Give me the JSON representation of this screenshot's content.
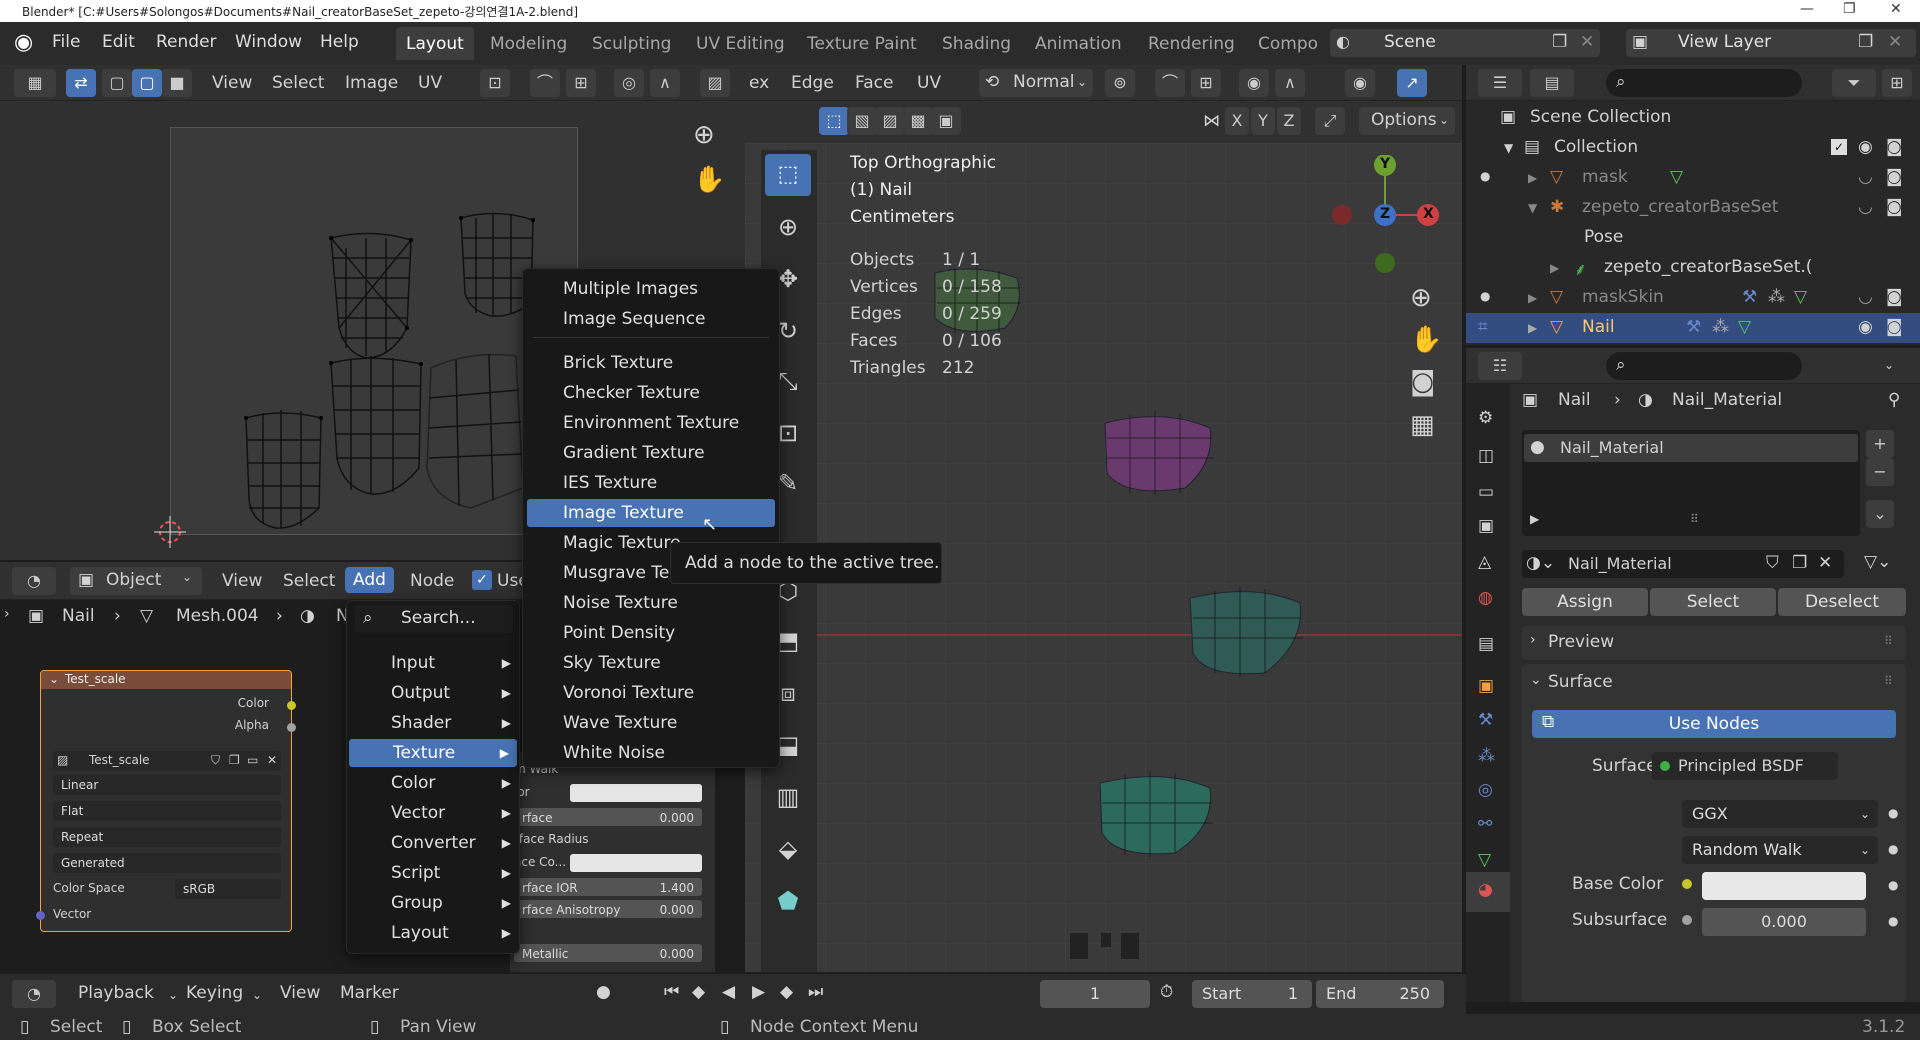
{
  "titlebar": {
    "title": "Blender* [C:#Users#Solongos#Documents#Nail_creatorBaseSet_zepeto-강의연결1A-2.blend]",
    "min": "—",
    "max": "❐",
    "close": "✕"
  },
  "menubar": {
    "items": [
      "File",
      "Edit",
      "Render",
      "Window",
      "Help"
    ]
  },
  "workspaces": {
    "tabs": [
      "Layout",
      "Modeling",
      "Sculpting",
      "UV Editing",
      "Texture Paint",
      "Shading",
      "Animation",
      "Rendering",
      "Compo"
    ]
  },
  "scene": {
    "name": "Scene",
    "view_layer": "View Layer"
  },
  "uv_editor": {
    "header": [
      "View",
      "Select",
      "Image",
      "UV"
    ]
  },
  "viewport": {
    "header": [
      "ex",
      "Edge",
      "Face",
      "UV"
    ],
    "shading_mode": "Normal",
    "options": "Options",
    "axes": [
      "X",
      "Y",
      "Z"
    ],
    "overlay_title": "Top Orthographic",
    "overlay_obj": "(1) Nail",
    "overlay_units": "Centimeters",
    "stats": [
      {
        "label": "Objects",
        "value": "1 / 1"
      },
      {
        "label": "Vertices",
        "value": "0 / 158"
      },
      {
        "label": "Edges",
        "value": "0 / 259"
      },
      {
        "label": "Faces",
        "value": "0 / 106"
      },
      {
        "label": "Triangles",
        "value": "212"
      }
    ],
    "gizmo": {
      "y": "Y",
      "z": "Z",
      "x": "X"
    }
  },
  "node_editor": {
    "mode": "Object",
    "header": [
      "View",
      "Select",
      "Add",
      "Node",
      "Use"
    ],
    "breadcrumb": [
      "Nail",
      "Mesh.004",
      "N"
    ],
    "node": {
      "title": "Test_scale",
      "outputs": [
        "Color",
        "Alpha"
      ],
      "image": "Test_scale",
      "dropdowns": [
        "Linear",
        "Flat",
        "Repeat",
        "Generated"
      ],
      "colorspace_label": "Color Space",
      "colorspace": "sRGB",
      "input": "Vector"
    },
    "bsdf_rows": [
      {
        "label": "m Walk",
        "value": ""
      },
      {
        "label": "lor",
        "value": ""
      },
      {
        "label": "rface",
        "value": "0.000"
      },
      {
        "label": "rface Radius",
        "value": ""
      },
      {
        "label": "ace Co...",
        "value": ""
      },
      {
        "label": "rface IOR",
        "value": "1.400"
      },
      {
        "label": "rface Anisotropy",
        "value": "0.000"
      },
      {
        "label": "Metallic",
        "value": "0.000"
      }
    ]
  },
  "add_menu": {
    "search": "Search...",
    "items": [
      "Input",
      "Output",
      "Shader",
      "Texture",
      "Color",
      "Vector",
      "Converter",
      "Script",
      "Group",
      "Layout"
    ],
    "selected": "Texture"
  },
  "texture_menu": {
    "items": [
      "Multiple Images",
      "Image Sequence",
      "Brick Texture",
      "Checker Texture",
      "Environment Texture",
      "Gradient Texture",
      "IES Texture",
      "Image Texture",
      "Magic Texture",
      "Musgrave Te",
      "Noise Texture",
      "Point Density",
      "Sky Texture",
      "Voronoi Texture",
      "Wave Texture",
      "White Noise"
    ],
    "selected": "Image Texture",
    "tooltip": "Add a node to the active tree."
  },
  "outliner": {
    "items": [
      {
        "label": "Scene Collection",
        "indent": 0
      },
      {
        "label": "Collection",
        "indent": 1
      },
      {
        "label": "mask",
        "indent": 2
      },
      {
        "label": "zepeto_creatorBaseSet",
        "indent": 2
      },
      {
        "label": "Pose",
        "indent": 3
      },
      {
        "label": "zepeto_creatorBaseSet.(",
        "indent": 3
      },
      {
        "label": "maskSkin",
        "indent": 2
      },
      {
        "label": "Nail",
        "indent": 2
      }
    ]
  },
  "properties": {
    "breadcrumb": [
      "Nail",
      "Nail_Material"
    ],
    "slot": "Nail_Material",
    "material_name": "Nail_Material",
    "buttons": [
      "Assign",
      "Select",
      "Deselect"
    ],
    "preview": "Preview",
    "surface_panel": "Surface",
    "use_nodes": "Use Nodes",
    "surface_label": "Surface",
    "surface_value": "Principled BSDF",
    "distribution": "GGX",
    "subsurface_method": "Random Walk",
    "base_color_label": "Base Color",
    "subsurface_label": "Subsurface",
    "subsurface_value": "0.000"
  },
  "timeline": {
    "header": [
      "Playback",
      "Keying",
      "View",
      "Marker"
    ],
    "frame": "1",
    "start_label": "Start",
    "start": "1",
    "end_label": "End",
    "end": "250"
  },
  "statusbar": {
    "items": [
      "Select",
      "Box Select",
      "Pan View",
      "Node Context Menu"
    ],
    "version": "3.1.2"
  },
  "colors": {
    "accent": "#4772b3",
    "bg": "#1d1d1d",
    "panel": "#2f2f2f",
    "menu": "#181818"
  }
}
